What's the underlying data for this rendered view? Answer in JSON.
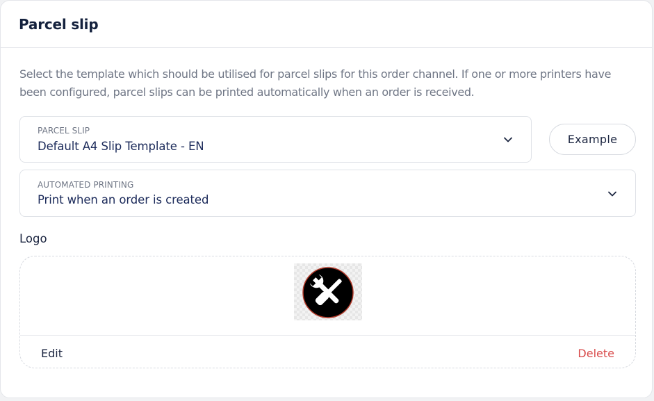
{
  "card": {
    "title": "Parcel slip",
    "description": "Select the template which should be utilised for parcel slips for this order channel. If one or more printers have been configured, parcel slips can be printed automatically when an order is received."
  },
  "parcel_slip": {
    "label": "PARCEL SLIP",
    "value": "Default A4 Slip Template - EN",
    "icon": "chevron-down-icon"
  },
  "example_button": {
    "label": "Example"
  },
  "automated_printing": {
    "label": "AUTOMATED PRINTING",
    "value": "Print when an order is created",
    "icon": "chevron-down-icon"
  },
  "logo": {
    "label": "Logo",
    "image_icon": "wrench-screwdriver-logo-icon",
    "edit_label": "Edit",
    "delete_label": "Delete"
  },
  "colors": {
    "text_primary": "#1b2540",
    "text_secondary": "#6f7685",
    "delete": "#d84a4a",
    "border": "#dfe2e7"
  }
}
